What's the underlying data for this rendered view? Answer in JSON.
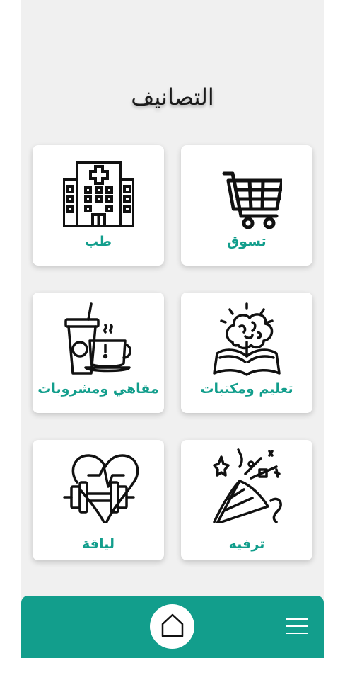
{
  "page": {
    "title": "التصانيف"
  },
  "categories": [
    {
      "id": "shopping",
      "label": "تسوق",
      "icon": "shopping-cart-icon"
    },
    {
      "id": "medicine",
      "label": "طب",
      "icon": "hospital-icon"
    },
    {
      "id": "education",
      "label": "تعليم ومكتبات",
      "icon": "brain-book-icon"
    },
    {
      "id": "cafes",
      "label": "مقاهي ومشروبات",
      "icon": "coffee-cup-icon"
    },
    {
      "id": "entertainment",
      "label": "ترفيه",
      "icon": "party-popper-icon"
    },
    {
      "id": "fitness",
      "label": "لياقة",
      "icon": "heart-dumbbell-icon"
    }
  ],
  "nav": {
    "home_icon": "home-icon",
    "menu_icon": "hamburger-menu-icon"
  },
  "colors": {
    "accent": "#129e8c",
    "background": "#f0f0f0",
    "card": "#ffffff",
    "title": "#1a1a1a"
  }
}
